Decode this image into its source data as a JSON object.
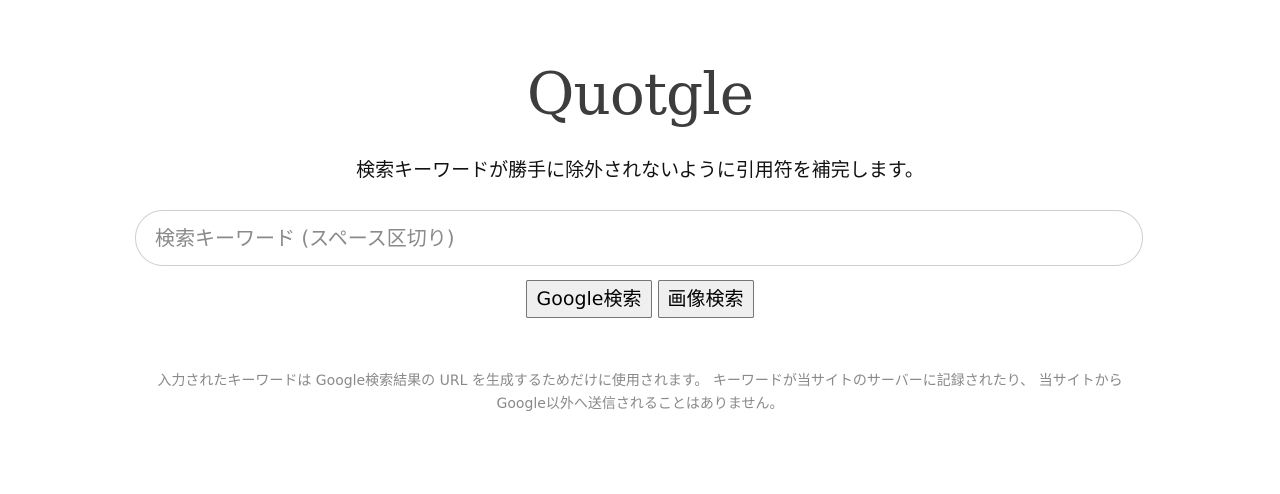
{
  "header": {
    "logo_text": "Quotgle",
    "tagline": "検索キーワードが勝手に除外されないように引用符を補完します。"
  },
  "search": {
    "value": "",
    "placeholder": "検索キーワード (スペース区切り)"
  },
  "actions": {
    "google_search_label": "Google検索",
    "image_search_label": "画像検索"
  },
  "footer": {
    "notice_line1": "入力されたキーワードは Google検索結果の URL を生成するためだけに使用されます。 キーワードが当サイトのサーバーに記録されたり、 当サイトから",
    "notice_line2": "Google以外へ送信されることはありません。"
  },
  "colors": {
    "logo": "#3d3d3d",
    "notice_text": "#8a8a8a",
    "search_border": "#cfcfcf",
    "button_bg": "#efefef"
  }
}
